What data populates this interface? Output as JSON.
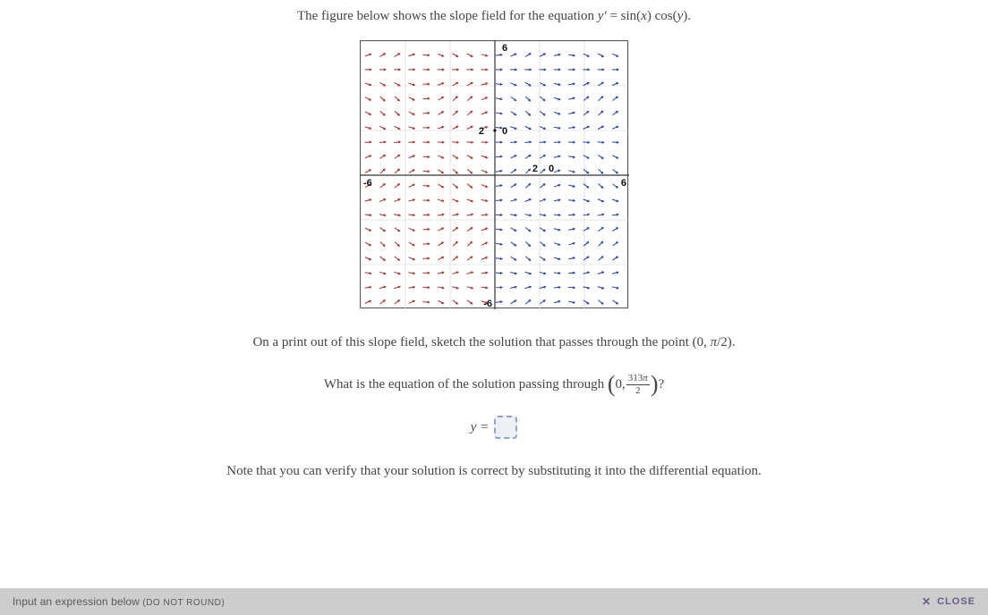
{
  "intro": {
    "prefix": "The figure below shows the slope field for the equation ",
    "eq_lhs": "y′",
    "eq_eq": " = ",
    "eq_rhs": "sin(x) cos(y)",
    "period": "."
  },
  "sketch": {
    "prefix": "On a print out of this slope field, sketch the solution that passes through the point ",
    "point": "(0, π/2)",
    "period": "."
  },
  "question": {
    "prefix": "What is the equation of the solution passing through ",
    "p_open": "(",
    "p_zero": "0, ",
    "frac_num": "313π",
    "frac_den": "2",
    "p_close": ")",
    "qmark": "?"
  },
  "answer": {
    "label": "y ="
  },
  "note": "Note that you can verify that your solution is correct by substituting it into the differential equation.",
  "footer": {
    "prompt_a": "Input an expression below ",
    "prompt_b": "(DO NOT ROUND)",
    "close": "CLOSE"
  },
  "chart_data": {
    "type": "slopefield",
    "equation": "y' = sin(x) cos(y)",
    "xlim": [
      -6,
      6
    ],
    "ylim": [
      -6,
      6
    ],
    "axis_ticks_x": [
      -6,
      2,
      6
    ],
    "axis_ticks_y": [
      -6,
      2,
      6
    ],
    "grid_step": 2,
    "sample_step": 0.65,
    "arrow_color_left": "#b02a2a",
    "arrow_color_right": "#2a3ab0"
  }
}
